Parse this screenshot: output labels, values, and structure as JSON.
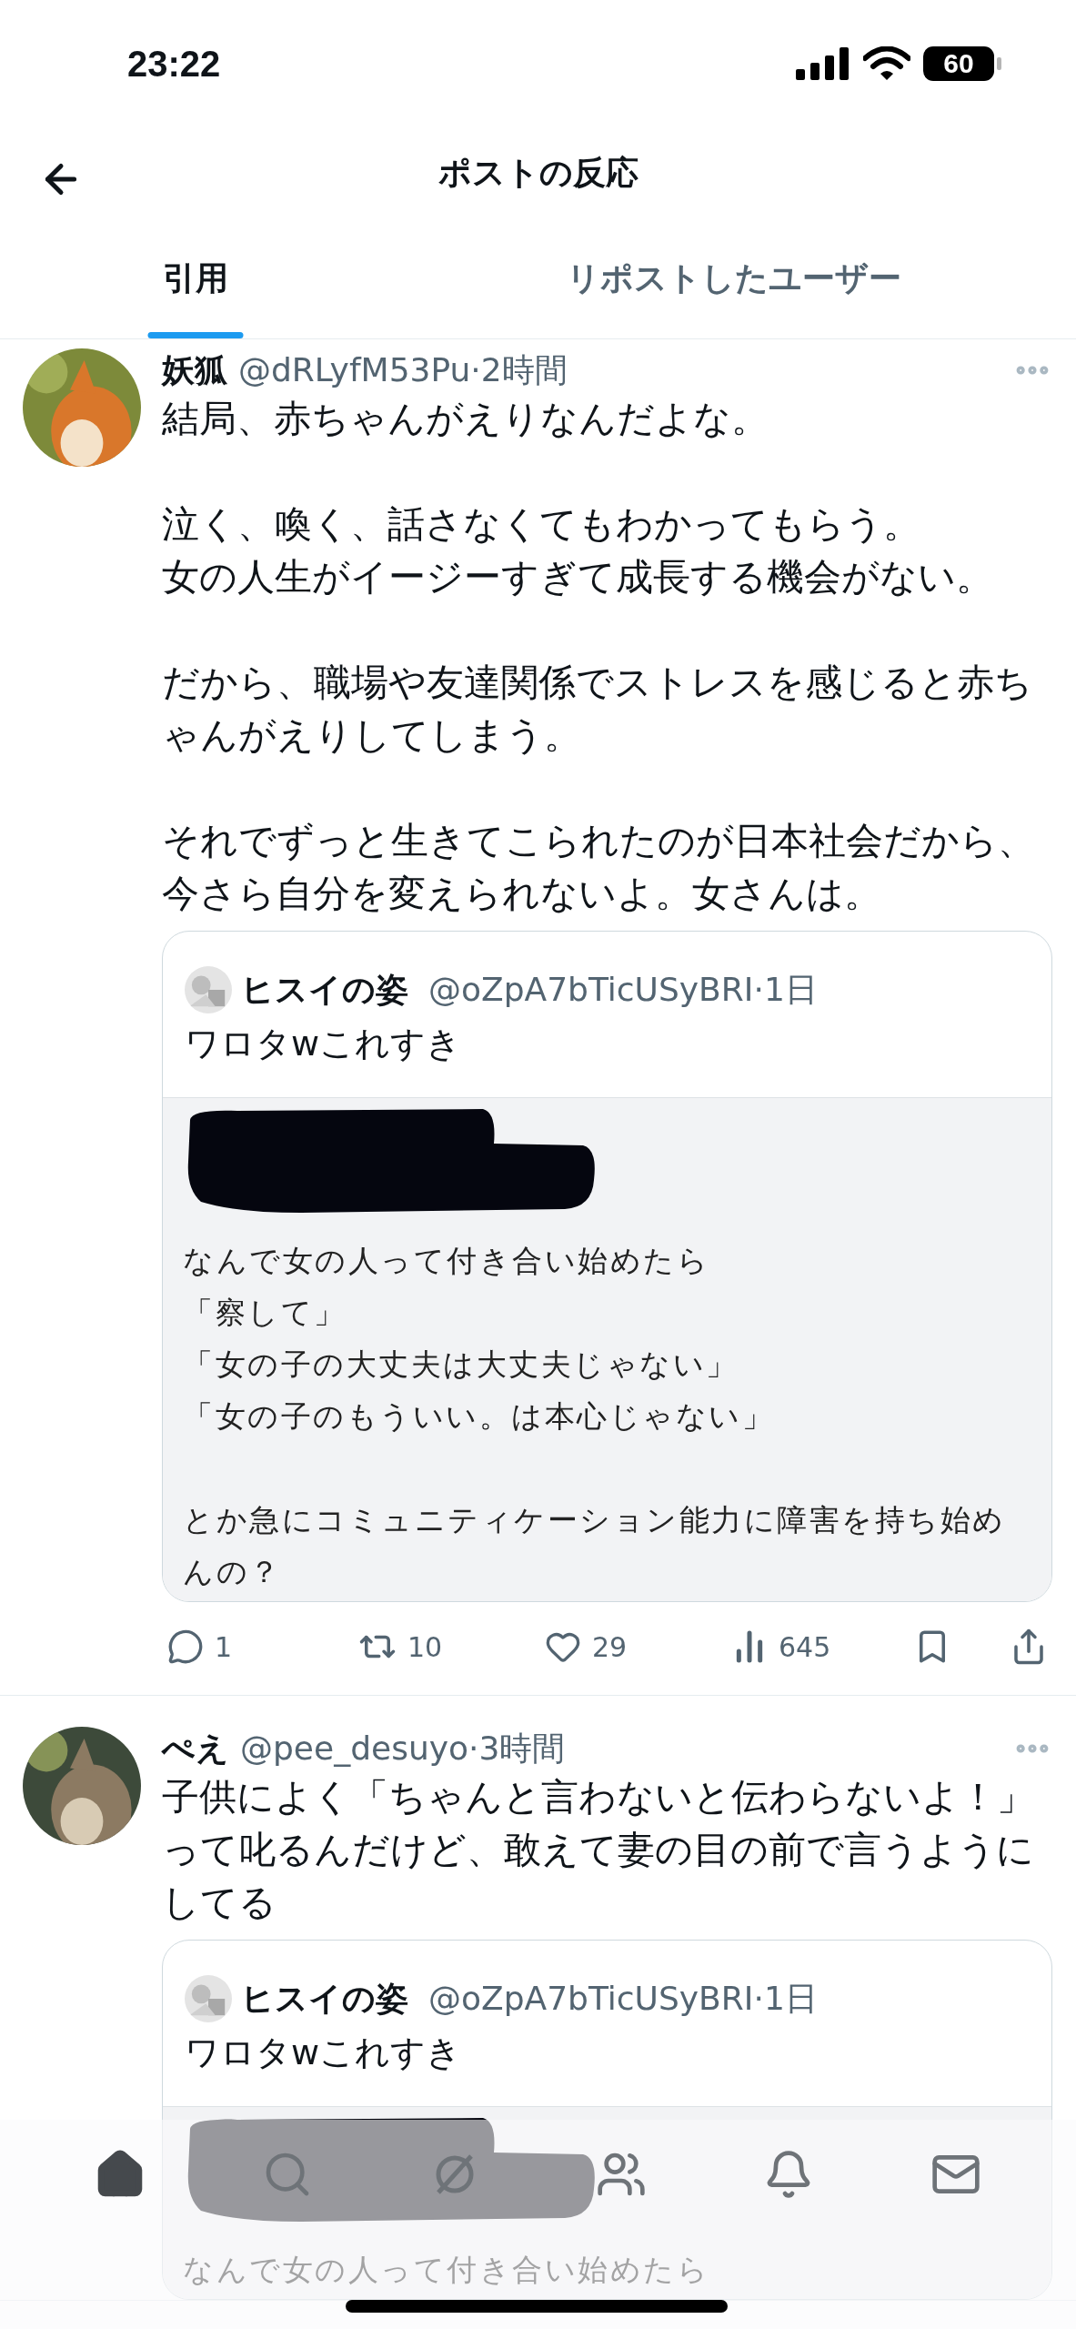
{
  "status_bar": {
    "time": "23:22",
    "battery": "60"
  },
  "header": {
    "title": "ポストの反応"
  },
  "tabs": [
    {
      "label": "引用",
      "selected": true
    },
    {
      "label": "リポストしたユーザー",
      "selected": false
    }
  ],
  "posts": [
    {
      "name": "妖狐",
      "meta": "@dRLyfM53Pu·2時間",
      "body": [
        [
          "結局、赤ちゃんがえりなんだよな。"
        ],
        [
          "泣く、喚く、話さなくてもわかってもらう。",
          "女の人生がイージーすぎて成長する機会がない。"
        ],
        [
          "だから、職場や友達関係でストレスを感じると赤ちゃんがえりしてしまう。"
        ],
        [
          "それでずっと生きてこられたのが日本社会だから、",
          "今さら自分を変えられないよ。女さんは。"
        ]
      ],
      "quote": {
        "name": "ヒスイの姿",
        "meta": "@oZpA7bTicUSyBRI·1日",
        "text": "ワロタwこれすき",
        "image_text": [
          [
            "なんで女の人って付き合い始めたら",
            "「察して」",
            "「女の子の大丈夫は大丈夫じゃない」",
            "「女の子のもういい。は本心じゃない」"
          ],
          [
            "とか急にコミュニティケーション能力に障害を持ち始めんの？"
          ]
        ]
      },
      "stats": {
        "replies": "1",
        "reposts": "10",
        "likes": "29",
        "views": "645"
      }
    },
    {
      "name": "ぺえ",
      "meta": "@pee_desuyo·3時間",
      "body": [
        [
          "子供によく「ちゃんと言わないと伝わらないよ！」って叱るんだけど、敢えて妻の目の前で言うようにしてる"
        ]
      ],
      "quote": {
        "name": "ヒスイの姿",
        "meta": "@oZpA7bTicUSyBRI·1日",
        "text": "ワロタwこれすき",
        "image_text": [
          [
            "なんで女の人って付き合い始めたら"
          ]
        ]
      }
    }
  ],
  "nav": [
    {
      "kind": "home",
      "selected": true
    },
    {
      "kind": "search",
      "selected": false
    },
    {
      "kind": "grok",
      "selected": false
    },
    {
      "kind": "communities",
      "selected": false
    },
    {
      "kind": "notifications",
      "selected": false
    },
    {
      "kind": "messages",
      "selected": false
    }
  ]
}
